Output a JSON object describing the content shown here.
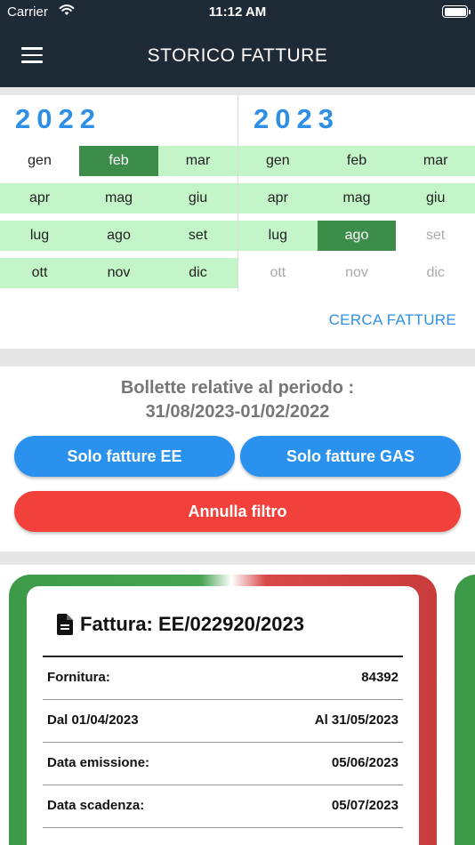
{
  "status": {
    "carrier": "Carrier",
    "time": "11:12 AM"
  },
  "header": {
    "title": "STORICO FATTURE"
  },
  "calendar": {
    "years": [
      {
        "label": "2022",
        "rows": [
          [
            {
              "m": "gen",
              "s": "plain"
            },
            {
              "m": "feb",
              "s": "sel"
            },
            {
              "m": "mar",
              "s": "avail"
            }
          ],
          [
            {
              "m": "apr",
              "s": "avail"
            },
            {
              "m": "mag",
              "s": "avail"
            },
            {
              "m": "giu",
              "s": "avail"
            }
          ],
          [
            {
              "m": "lug",
              "s": "avail"
            },
            {
              "m": "ago",
              "s": "avail"
            },
            {
              "m": "set",
              "s": "avail"
            }
          ],
          [
            {
              "m": "ott",
              "s": "avail"
            },
            {
              "m": "nov",
              "s": "avail"
            },
            {
              "m": "dic",
              "s": "avail"
            }
          ]
        ]
      },
      {
        "label": "2023",
        "rows": [
          [
            {
              "m": "gen",
              "s": "avail"
            },
            {
              "m": "feb",
              "s": "avail"
            },
            {
              "m": "mar",
              "s": "avail"
            }
          ],
          [
            {
              "m": "apr",
              "s": "avail"
            },
            {
              "m": "mag",
              "s": "avail"
            },
            {
              "m": "giu",
              "s": "avail"
            }
          ],
          [
            {
              "m": "lug",
              "s": "avail"
            },
            {
              "m": "ago",
              "s": "sel"
            },
            {
              "m": "set",
              "s": "dis"
            }
          ],
          [
            {
              "m": "ott",
              "s": "dis"
            },
            {
              "m": "nov",
              "s": "dis"
            },
            {
              "m": "dic",
              "s": "dis"
            }
          ]
        ]
      }
    ],
    "search_label": "CERCA FATTURE"
  },
  "filter": {
    "period_title": "Bollette relative al periodo :",
    "period_range": "31/08/2023-01/02/2022",
    "ee_label": "Solo fatture EE",
    "gas_label": "Solo fatture GAS",
    "reset_label": "Annulla filtro"
  },
  "invoice": {
    "title": "Fattura: EE/022920/2023",
    "rows": [
      {
        "label": "Fornitura:",
        "value": "84392"
      },
      {
        "label": "Dal 01/04/2023",
        "value": "Al 31/05/2023"
      },
      {
        "label": "Data emissione:",
        "value": "05/06/2023"
      },
      {
        "label": "Data scadenza:",
        "value": "05/07/2023"
      }
    ]
  },
  "colors": {
    "header_bg": "#1f2a37",
    "accent_blue": "#2a92ee",
    "danger_red": "#f2413b",
    "month_available": "#c3f5c8",
    "month_selected": "#3c8d4a"
  }
}
